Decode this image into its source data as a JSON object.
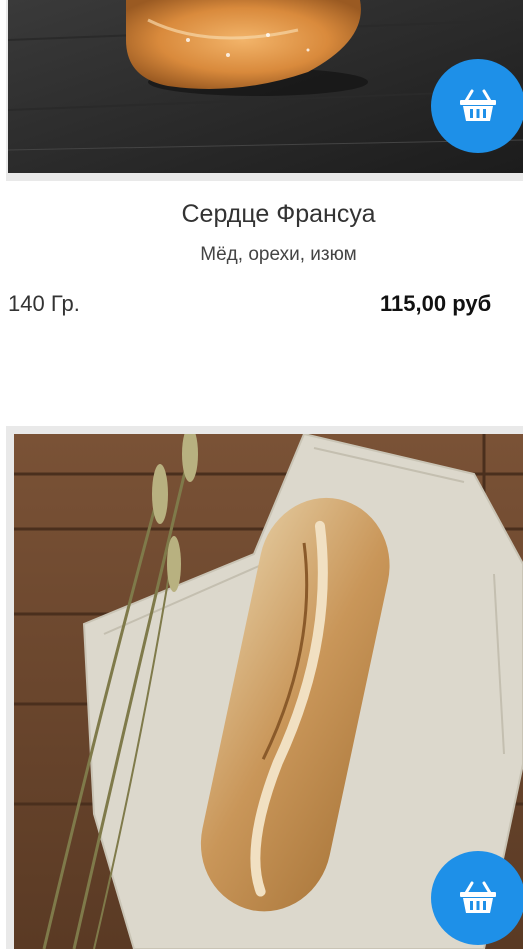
{
  "products": [
    {
      "image": "bread-heart-photo",
      "title": "",
      "description": "",
      "weight": "",
      "price": "",
      "cart_icon": "basket-icon"
    },
    {
      "image": "bread-photo",
      "title": "Сердце Франсуа",
      "description": "Мёд, орехи, изюм",
      "weight": "140 Гр.",
      "price": "115,00 руб",
      "cart_icon": "basket-icon"
    },
    {
      "image": "baguette-on-linen-photo",
      "title": "",
      "description": "",
      "weight": "",
      "price": "",
      "cart_icon": "basket-icon"
    }
  ],
  "colors": {
    "accent": "#1e90e8",
    "frame": "#e9e9e9",
    "text": "#333333"
  }
}
